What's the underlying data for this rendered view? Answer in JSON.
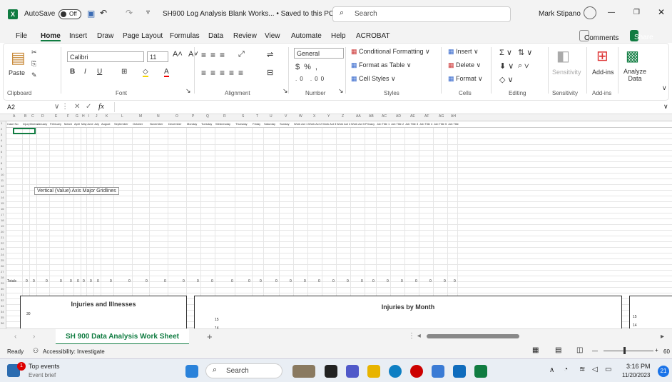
{
  "titlebar": {
    "autosave": "AutoSave",
    "toggle": "Off",
    "filename": "SH900 Log Analysis Blank Works... • Saved to this PC ∨",
    "search_placeholder": "Search",
    "user": "Mark Stipano"
  },
  "menu": [
    "File",
    "Home",
    "Insert",
    "Draw",
    "Page Layout",
    "Formulas",
    "Data",
    "Review",
    "View",
    "Automate",
    "Help",
    "ACROBAT"
  ],
  "menu_buttons": {
    "comments": "Comments",
    "share": "Share"
  },
  "ribbon": {
    "clipboard": {
      "paste": "Paste",
      "label": "Clipboard"
    },
    "font": {
      "name": "Calibri",
      "size": "11",
      "label": "Font"
    },
    "alignment": {
      "label": "Alignment"
    },
    "number": {
      "format": "General",
      "label": "Number"
    },
    "styles": {
      "cond": "Conditional Formatting ∨",
      "table": "Format as Table ∨",
      "cell": "Cell Styles ∨",
      "label": "Styles"
    },
    "cells": {
      "insert": "Insert ∨",
      "delete": "Delete ∨",
      "format": "Format ∨",
      "label": "Cells"
    },
    "editing": {
      "label": "Editing"
    },
    "sensitivity": {
      "btn": "Sensitivity",
      "label": "Sensitivity"
    },
    "addins": {
      "btn": "Add-ins",
      "label": "Add-ins"
    },
    "analyze": {
      "btn": "Analyze Data"
    }
  },
  "formula_bar": {
    "cell": "A2",
    "fx": "fx"
  },
  "columns": [
    "A",
    "B",
    "C",
    "D",
    "E",
    "F",
    "G",
    "H",
    "I",
    "J",
    "K",
    "L",
    "M",
    "N",
    "O",
    "P",
    "Q",
    "R",
    "S",
    "T",
    "U",
    "V",
    "W",
    "X",
    "Y",
    "Z",
    "AA",
    "AB",
    "AC",
    "AD",
    "AE",
    "AF",
    "AG",
    "AH"
  ],
  "header_row": [
    "Case No",
    "Injury",
    "Illness",
    "January",
    "February",
    "March",
    "April",
    "May",
    "June",
    "July",
    "August",
    "September",
    "October",
    "November",
    "December",
    "Monday",
    "Tuesday",
    "Wednesday",
    "Thursday",
    "Friday",
    "Saturday",
    "Sunday",
    "Work Act 1",
    "Work Act 2",
    "Work Act 3",
    "Work Act 4",
    "Work Act 5",
    "Privacy",
    "Job Title 1",
    "Job Title 2",
    "Job Title 3",
    "Job Title 4",
    "Job Title 5",
    "Job Title"
  ],
  "totals_label": "Totals",
  "totals_value": "0",
  "tooltip": "Vertical (Value) Axis Major Gridlines",
  "charts": {
    "c1": {
      "title": "Injuries and Illnesses",
      "tick": "30"
    },
    "c2": {
      "title": "Injuries by Month",
      "ticks": [
        "15",
        "14"
      ]
    },
    "c3": {
      "ticks": [
        "15",
        "14"
      ]
    }
  },
  "sheet_tab": "SH 900 Data Analysis Work Sheet",
  "status": {
    "ready": "Ready",
    "accessibility": "Accessibility: Investigate",
    "zoom": "60"
  },
  "taskbar": {
    "events_title": "Top events",
    "events_sub": "Event brief",
    "badge": "1",
    "search": "Search",
    "time": "3:16 PM",
    "date": "11/20/2023",
    "notif": "21"
  }
}
